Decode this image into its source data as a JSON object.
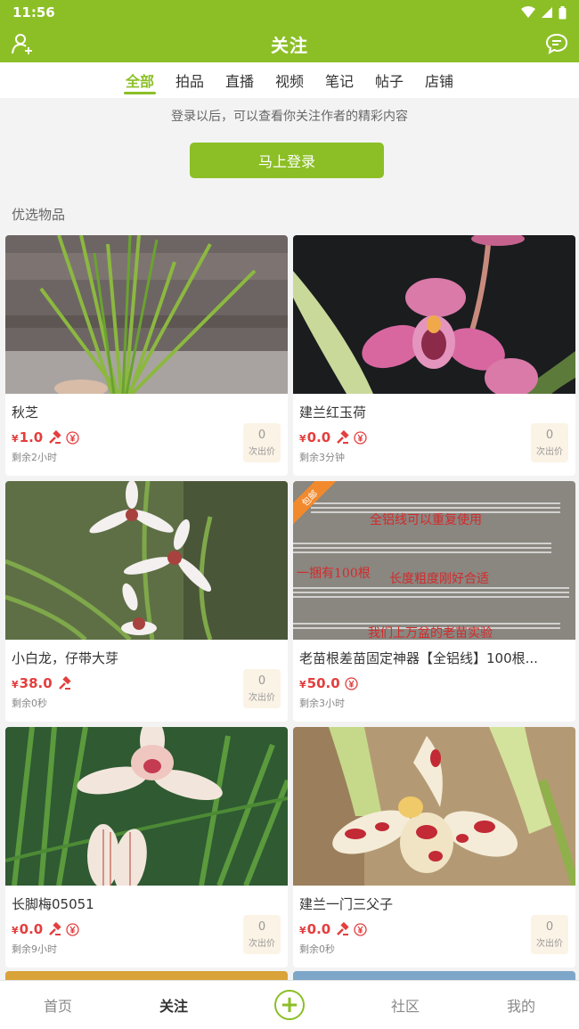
{
  "status": {
    "time": "11:56"
  },
  "header": {
    "title": "关注"
  },
  "tabs": [
    {
      "label": "全部",
      "active": true
    },
    {
      "label": "拍品",
      "active": false
    },
    {
      "label": "直播",
      "active": false
    },
    {
      "label": "视频",
      "active": false
    },
    {
      "label": "笔记",
      "active": false
    },
    {
      "label": "帖子",
      "active": false
    },
    {
      "label": "店铺",
      "active": false
    }
  ],
  "login": {
    "text": "登录以后，可以查看你关注作者的精彩内容",
    "button": "马上登录"
  },
  "section_title": "优选物品",
  "items": [
    {
      "title": "秋芝",
      "yen": "¥",
      "price": "1.0",
      "remain": "剩余2小时",
      "bids": "0",
      "bid_label": "次出价",
      "tag": ""
    },
    {
      "title": "建兰红玉荷",
      "yen": "¥",
      "price": "0.0",
      "remain": "剩余3分钟",
      "bids": "0",
      "bid_label": "次出价",
      "tag": ""
    },
    {
      "title": "小白龙，仔带大芽",
      "yen": "¥",
      "price": "38.0",
      "remain": "剩余0秒",
      "bids": "0",
      "bid_label": "次出价",
      "tag": ""
    },
    {
      "title": "老苗根差苗固定神器【全铝线】100根...",
      "yen": "¥",
      "price": "50.0",
      "remain": "剩余3小时",
      "bids": "",
      "bid_label": "",
      "tag": "包邮",
      "image_text": [
        "全铝线可以重复使用",
        "一捆有100根",
        "长度粗度刚好合适",
        "我们上万盆的老苗实验"
      ]
    },
    {
      "title": "长脚梅05051",
      "yen": "¥",
      "price": "0.0",
      "remain": "剩余9小时",
      "bids": "0",
      "bid_label": "次出价",
      "tag": ""
    },
    {
      "title": "建兰一门三父子",
      "yen": "¥",
      "price": "0.0",
      "remain": "剩余0秒",
      "bids": "0",
      "bid_label": "次出价",
      "tag": ""
    }
  ],
  "bottom_nav": {
    "home": "首页",
    "follow": "关注",
    "community": "社区",
    "mine": "我的"
  },
  "colors": {
    "brand": "#8cbf26",
    "price": "#e43e3e"
  }
}
